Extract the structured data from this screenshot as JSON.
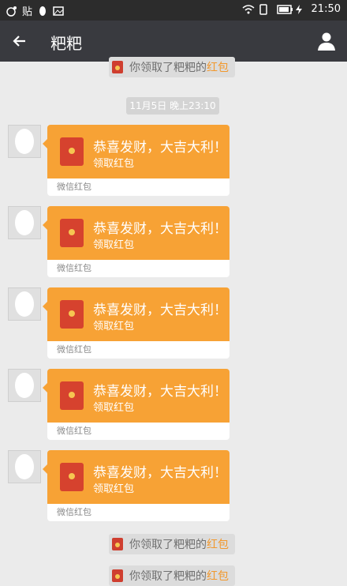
{
  "status": {
    "left_icons": [
      "weibo",
      "贴",
      "qq",
      "wechat-photo"
    ],
    "time": "21:50"
  },
  "header": {
    "title": "粑粑"
  },
  "system": {
    "you_received": "你领取了",
    "name": "粑粑",
    "de": "的",
    "redpacket": "红包"
  },
  "timestamp": "11月5日 晚上23:10",
  "messages": [
    {
      "greeting": "恭喜发财，大吉大利！",
      "claim": "领取红包",
      "label": "微信红包"
    },
    {
      "greeting": "恭喜发财，大吉大利！",
      "claim": "领取红包",
      "label": "微信红包"
    },
    {
      "greeting": "恭喜发财，大吉大利！",
      "claim": "领取红包",
      "label": "微信红包"
    },
    {
      "greeting": "恭喜发财，大吉大利！",
      "claim": "领取红包",
      "label": "微信红包"
    },
    {
      "greeting": "恭喜发财，大吉大利！",
      "claim": "领取红包",
      "label": "微信红包"
    }
  ],
  "colors": {
    "bubble": "#f7a235",
    "header": "#393a3f",
    "status": "#2c2c2c",
    "background": "#ebebeb"
  }
}
